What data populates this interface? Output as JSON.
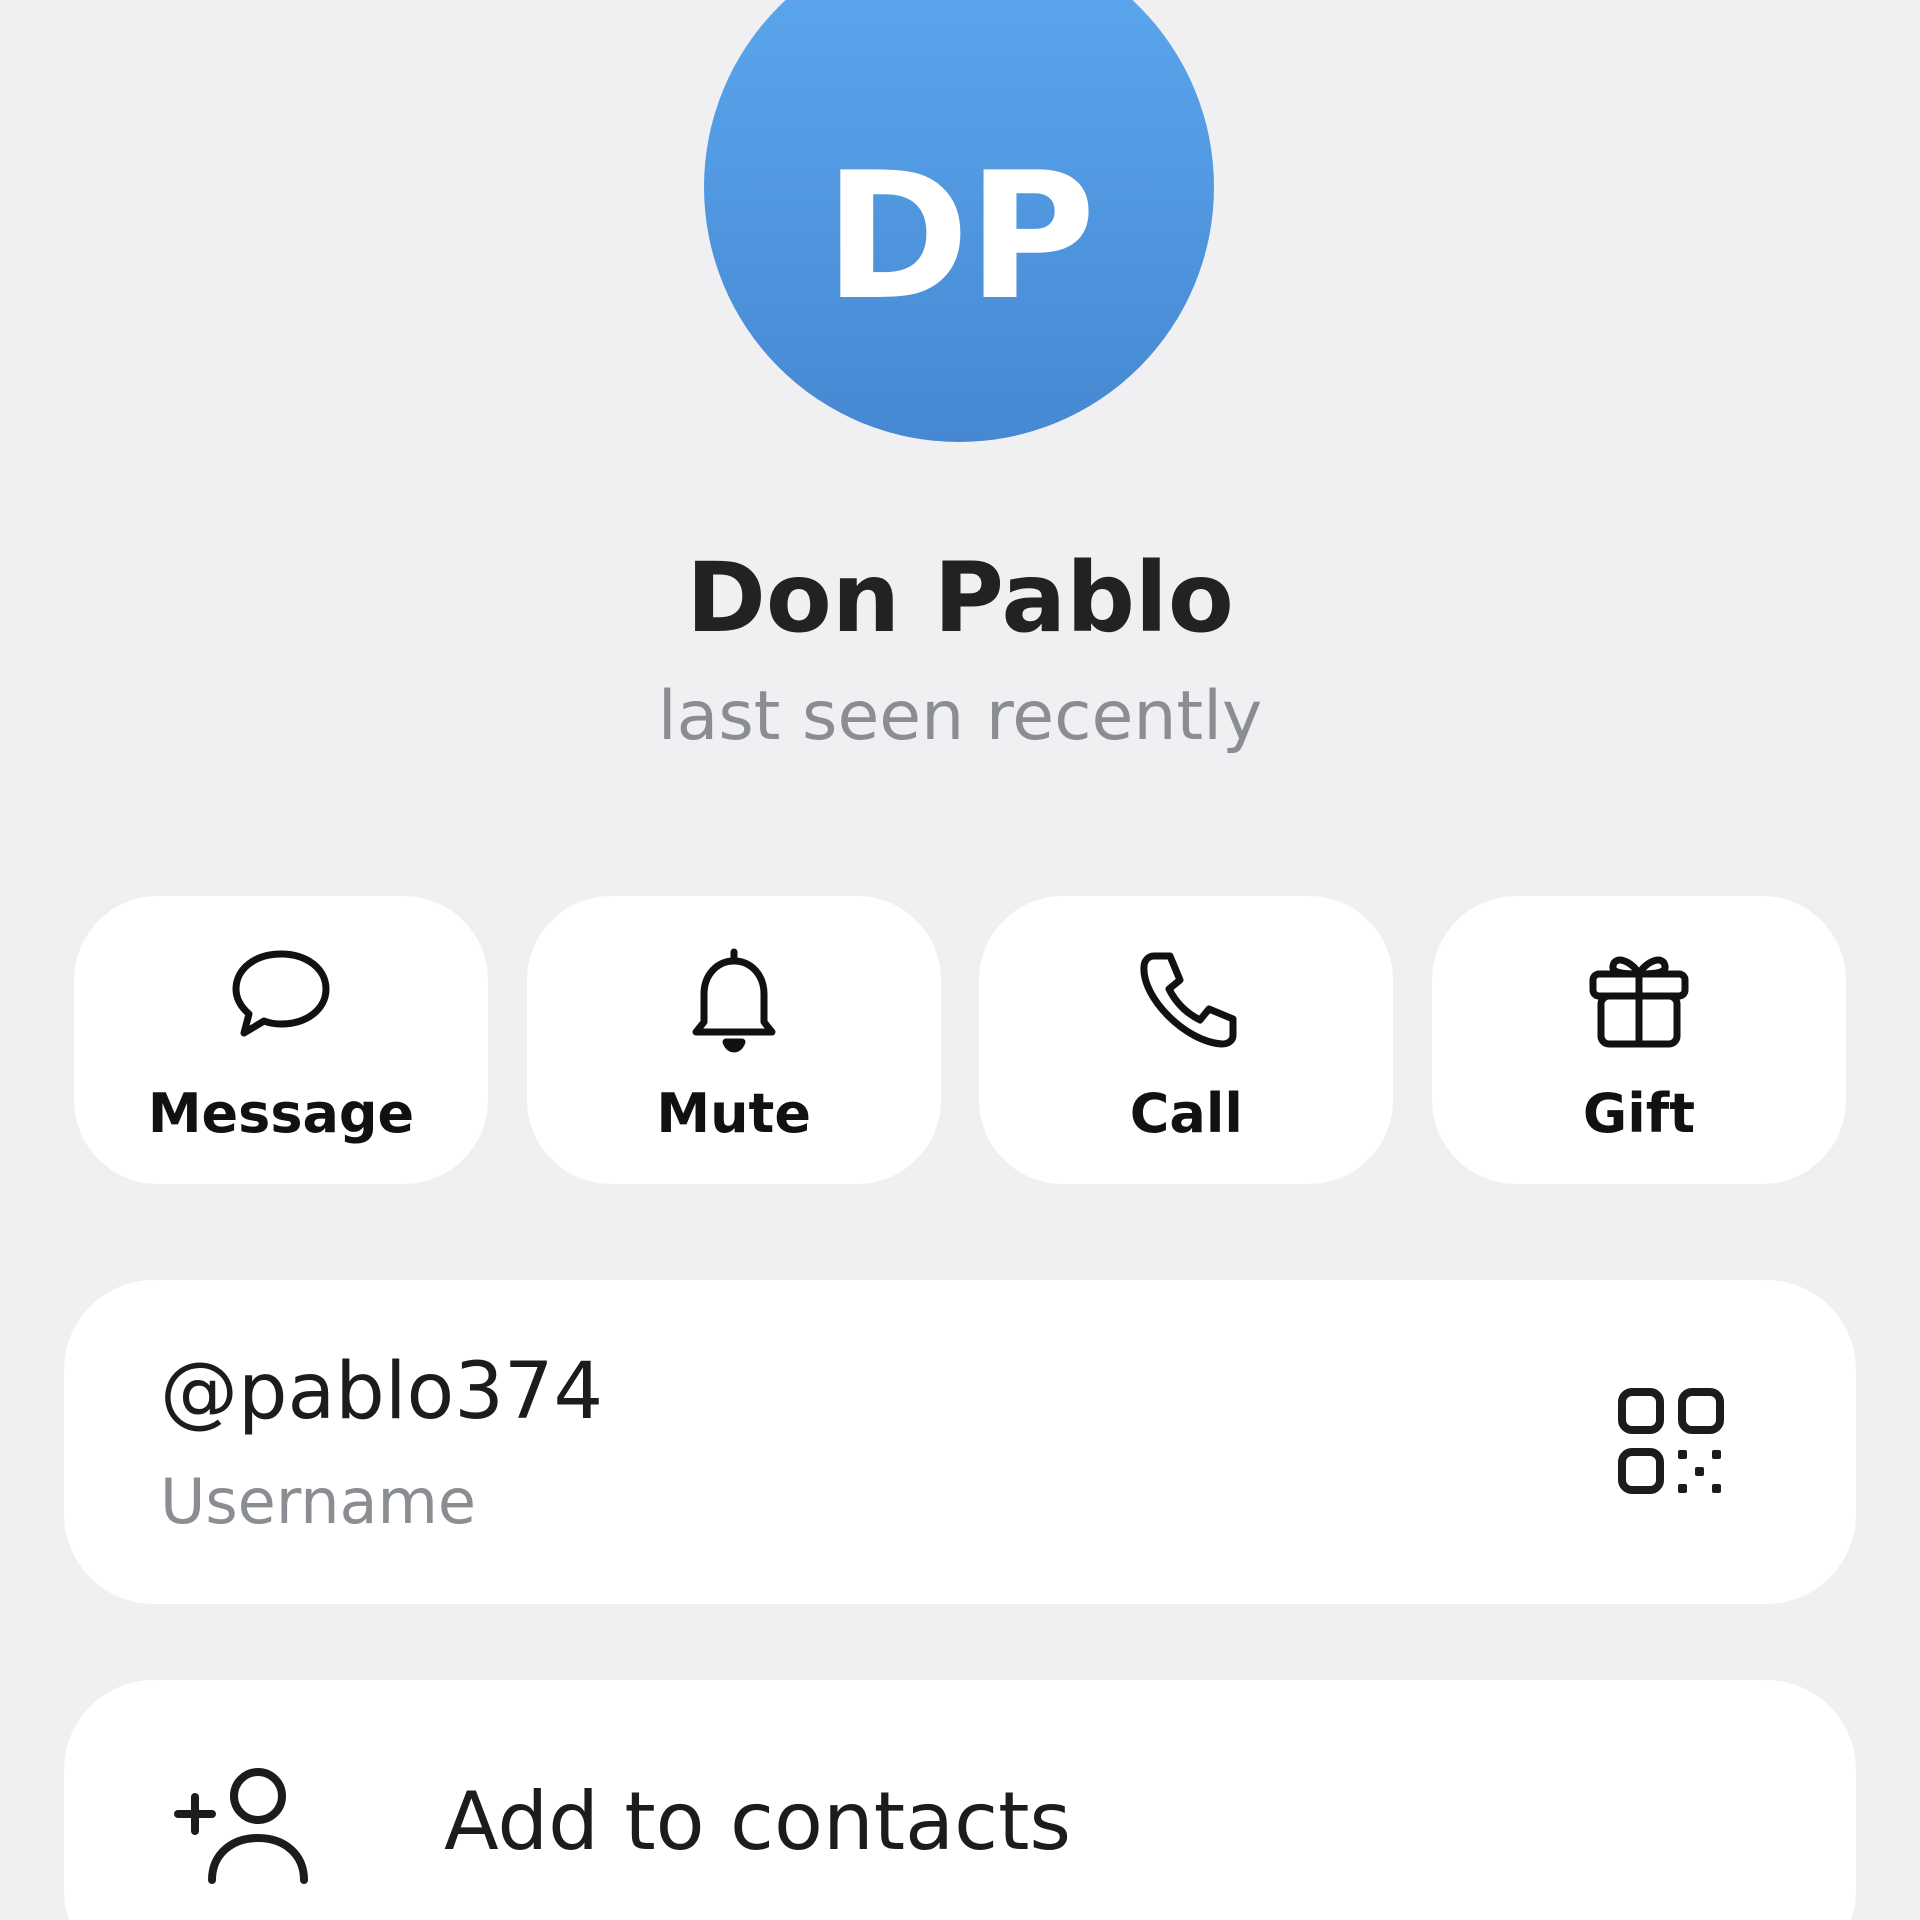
{
  "profile": {
    "initials": "DP",
    "name": "Don Pablo",
    "status": "last seen recently",
    "avatar_colors": [
      "#5ca9f0",
      "#4688d2"
    ]
  },
  "actions": [
    {
      "label": "Message",
      "icon": "chat-bubble-icon"
    },
    {
      "label": "Mute",
      "icon": "bell-icon"
    },
    {
      "label": "Call",
      "icon": "phone-icon"
    },
    {
      "label": "Gift",
      "icon": "gift-icon"
    }
  ],
  "username": {
    "value": "@pablo374",
    "label": "Username",
    "icon": "qr-code-icon"
  },
  "contacts": {
    "label": "Add to contacts",
    "icon": "add-user-icon"
  }
}
